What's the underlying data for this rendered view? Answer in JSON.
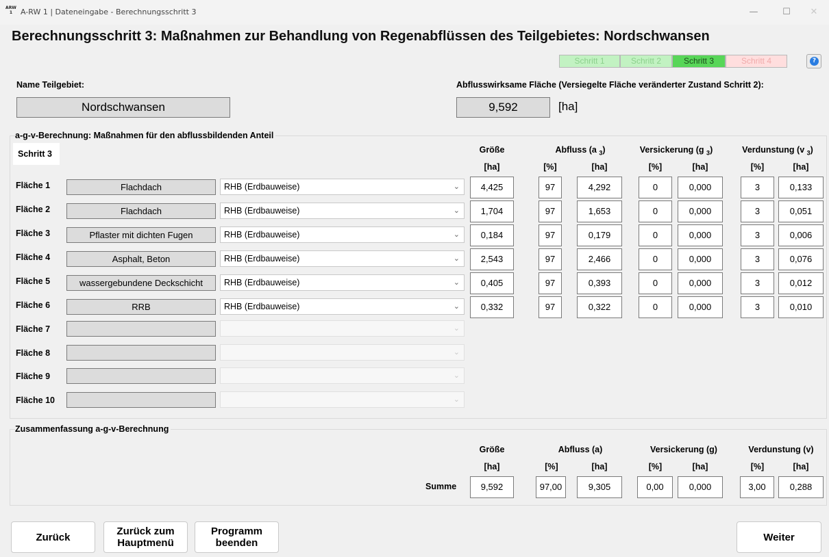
{
  "window": {
    "app_icon_top": "ARW",
    "app_icon_bottom": "1",
    "title": "A-RW 1 | Dateneingabe - Berechnungsschritt 3",
    "minimize_glyph": "—",
    "maximize_glyph": "☐",
    "close_glyph": "✕"
  },
  "heading": "Berechnungsschritt 3: Maßnahmen zur Behandlung von Regenabflüssen des Teilgebietes: Nordschwansen",
  "steps": [
    "Schritt 1",
    "Schritt 2",
    "Schritt 3",
    "Schritt 4"
  ],
  "active_step": "Schritt 3",
  "step_colors": {
    "done": "#c2f2c2",
    "active": "#58d658",
    "pending": "#ffdede"
  },
  "help_glyph": "?",
  "teilgebiet": {
    "label": "Name Teilgebiet:",
    "value": "Nordschwansen"
  },
  "flaeche": {
    "label": "Abflusswirksame Fläche (Versiegelte Fläche veränderter Zustand Schritt 2):",
    "value": "9,592",
    "unit": "[ha]"
  },
  "agv": {
    "group_title": "a-g-v-Berechnung: Maßnahmen für den abflussbildenden Anteil",
    "step_tag": "Schritt 3",
    "headers": {
      "groesse": "Größe",
      "abfluss": "Abfluss (a",
      "abfluss_sub": "3",
      "versickerung": "Versickerung (g",
      "versickerung_sub": "3",
      "verdunstung": "Verdunstung (v",
      "verdunstung_sub": "3",
      "close": ")",
      "unit_ha": "[ha]",
      "unit_pct": "[%]"
    },
    "rows": [
      {
        "label": "Fläche 1",
        "type": "Flachdach",
        "measure": "RHB (Erdbauweise)",
        "groesse": "4,425",
        "a_pct": "97",
        "a_ha": "4,292",
        "g_pct": "0",
        "g_ha": "0,000",
        "v_pct": "3",
        "v_ha": "0,133"
      },
      {
        "label": "Fläche 2",
        "type": "Flachdach",
        "measure": "RHB (Erdbauweise)",
        "groesse": "1,704",
        "a_pct": "97",
        "a_ha": "1,653",
        "g_pct": "0",
        "g_ha": "0,000",
        "v_pct": "3",
        "v_ha": "0,051"
      },
      {
        "label": "Fläche 3",
        "type": "Pflaster mit dichten Fugen",
        "measure": "RHB (Erdbauweise)",
        "groesse": "0,184",
        "a_pct": "97",
        "a_ha": "0,179",
        "g_pct": "0",
        "g_ha": "0,000",
        "v_pct": "3",
        "v_ha": "0,006"
      },
      {
        "label": "Fläche 4",
        "type": "Asphalt, Beton",
        "measure": "RHB (Erdbauweise)",
        "groesse": "2,543",
        "a_pct": "97",
        "a_ha": "2,466",
        "g_pct": "0",
        "g_ha": "0,000",
        "v_pct": "3",
        "v_ha": "0,076"
      },
      {
        "label": "Fläche 5",
        "type": "wassergebundene Deckschicht",
        "measure": "RHB (Erdbauweise)",
        "groesse": "0,405",
        "a_pct": "97",
        "a_ha": "0,393",
        "g_pct": "0",
        "g_ha": "0,000",
        "v_pct": "3",
        "v_ha": "0,012"
      },
      {
        "label": "Fläche 6",
        "type": "RRB",
        "measure": "RHB (Erdbauweise)",
        "groesse": "0,332",
        "a_pct": "97",
        "a_ha": "0,322",
        "g_pct": "0",
        "g_ha": "0,000",
        "v_pct": "3",
        "v_ha": "0,010"
      }
    ],
    "empty_rows": [
      "Fläche 7",
      "Fläche 8",
      "Fläche 9",
      "Fläche 10"
    ],
    "chevron": "⌄"
  },
  "summary": {
    "group_title": "Zusammenfassung a-g-v-Berechnung",
    "headers": {
      "groesse": "Größe",
      "abfluss": "Abfluss (a)",
      "versickerung": "Versickerung (g)",
      "verdunstung": "Verdunstung (v)",
      "unit_ha": "[ha]",
      "unit_pct": "[%]"
    },
    "summe_label": "Summe",
    "groesse": "9,592",
    "a_pct": "97,00",
    "a_ha": "9,305",
    "g_pct": "0,00",
    "g_ha": "0,000",
    "v_pct": "3,00",
    "v_ha": "0,288"
  },
  "buttons": {
    "back": "Zurück",
    "main_menu_line1": "Zurück zum",
    "main_menu_line2": "Hauptmenü",
    "exit_line1": "Programm",
    "exit_line2": "beenden",
    "next": "Weiter"
  }
}
